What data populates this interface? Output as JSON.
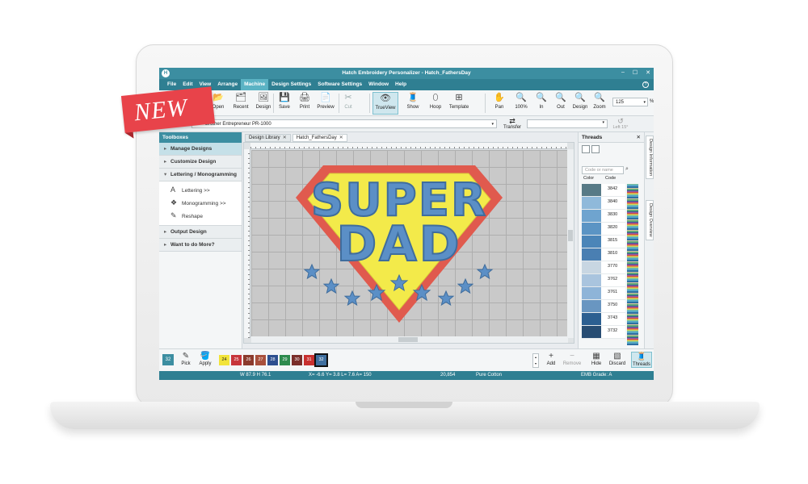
{
  "badge": {
    "label": "NEW"
  },
  "window": {
    "app_icon": "H",
    "title": "Hatch Embroidery Personalizer - Hatch_FathersDay",
    "controls": [
      "–",
      "☐",
      "✕"
    ]
  },
  "menu": {
    "items": [
      "File",
      "Edit",
      "View",
      "Arrange",
      "Machine",
      "Design Settings",
      "Software Settings",
      "Window",
      "Help"
    ],
    "active": "Machine"
  },
  "toolbar": {
    "open": "Open",
    "recent": "Recent",
    "design": "Design",
    "save": "Save",
    "print": "Print",
    "preview": "Preview",
    "cut": "Cut",
    "trueview": "TrueView",
    "show": "Show",
    "hoop": "Hoop",
    "template": "Template",
    "pan": "Pan",
    "zoom100": "100%",
    "zoom_in": "In",
    "zoom_out": "Out",
    "zoom_design": "Design",
    "zoom_zoom": "Zoom",
    "zoom_value": "125",
    "zoom_unit": "%"
  },
  "machine": {
    "selected": "Brother Entrepreneur PR-1000",
    "transfer": "Transfer",
    "rotate_left": "Left 15°"
  },
  "toolboxes": {
    "title": "Toolboxes",
    "sections": {
      "manage": "Manage Designs",
      "customize": "Customize Design",
      "lettering": "Lettering / Monogramming",
      "output": "Output Design",
      "more": "Want to do More?"
    },
    "tools": {
      "lettering": "Lettering >>",
      "monogramming": "Monogramming >>",
      "reshape": "Reshape"
    }
  },
  "tabs": {
    "library": "Design Library",
    "document": "Hatch_FathersDay",
    "close": "✕"
  },
  "design": {
    "line1": "SUPER",
    "line2": "DAD",
    "colors": {
      "shield_outline": "#e05a4e",
      "shield_fill": "#f3ea4a",
      "letters": "#5b8fc6",
      "letter_outline": "#3f6d9d",
      "stars": "#5b8fc6"
    }
  },
  "threads": {
    "title": "Threads",
    "search_placeholder": "Code or name",
    "col_color": "Color",
    "col_code": "Code",
    "rows": [
      {
        "code": "3842",
        "color": "#577a86"
      },
      {
        "code": "3840",
        "color": "#8fb9da"
      },
      {
        "code": "3830",
        "color": "#6fa4cf"
      },
      {
        "code": "3820",
        "color": "#5b94c4"
      },
      {
        "code": "3815",
        "color": "#4b85b8"
      },
      {
        "code": "3810",
        "color": "#4a7fb2"
      },
      {
        "code": "3770",
        "color": "#c8d6e2"
      },
      {
        "code": "3762",
        "color": "#a9c4de"
      },
      {
        "code": "3761",
        "color": "#8eb4d8"
      },
      {
        "code": "3750",
        "color": "#6996c1"
      },
      {
        "code": "3743",
        "color": "#2c5f91"
      },
      {
        "code": "3732",
        "color": "#284d73"
      }
    ],
    "side_tabs": [
      "Design Information",
      "Design Overview"
    ]
  },
  "bottom": {
    "count": "32",
    "pick": "Pick",
    "apply": "Apply",
    "swatches": [
      {
        "label": "24",
        "color": "#f2e43a",
        "text": "#222"
      },
      {
        "label": "25",
        "color": "#c7353b",
        "text": "#fff"
      },
      {
        "label": "26",
        "color": "#8b3a2c",
        "text": "#fff"
      },
      {
        "label": "27",
        "color": "#a8503c",
        "text": "#fff"
      },
      {
        "label": "28",
        "color": "#2d4f8f",
        "text": "#fff"
      },
      {
        "label": "29",
        "color": "#2e8b4e",
        "text": "#fff"
      },
      {
        "label": "30",
        "color": "#7a2e2a",
        "text": "#fff"
      },
      {
        "label": "31",
        "color": "#c8302f",
        "text": "#fff"
      },
      {
        "label": "32",
        "color": "#3f6f9f",
        "text": "#fff"
      }
    ],
    "add": "Add",
    "remove": "Remove",
    "hide": "Hide",
    "discard": "Discard",
    "threads": "Threads"
  },
  "status": {
    "size": "W 87.9 H 76.1",
    "coords": "X= -6.6 Y= 3.8 L= 7.6 A= 150",
    "stitches": "20,854",
    "thread": "Pure Cotton",
    "grade": "EMB Grade: A"
  }
}
